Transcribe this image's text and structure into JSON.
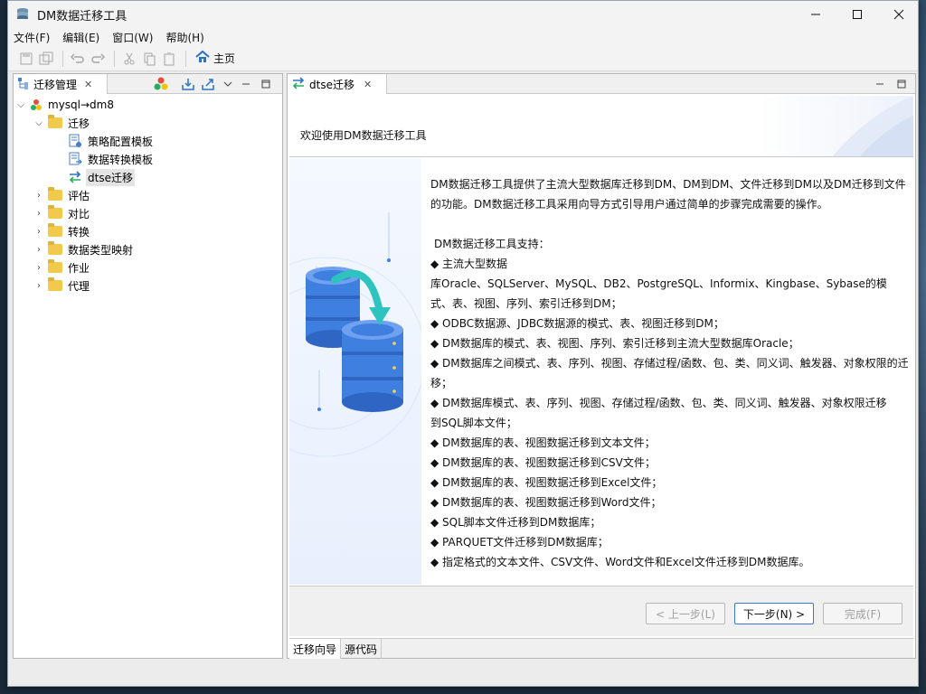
{
  "window": {
    "title": "DM数据迁移工具"
  },
  "menu": [
    {
      "label": "文件(F)"
    },
    {
      "label": "编辑(E)"
    },
    {
      "label": "窗口(W)"
    },
    {
      "label": "帮助(H)"
    }
  ],
  "toolbar": {
    "home_label": "主页"
  },
  "left_panel": {
    "tab_label": "迁移管理"
  },
  "tree": {
    "root": "mysql→dm8",
    "migration_folder": "迁移",
    "children": [
      "策略配置模板",
      "数据转换模板",
      "dtse迁移"
    ],
    "folders": [
      "评估",
      "对比",
      "转换",
      "数据类型映射",
      "作业",
      "代理"
    ]
  },
  "right_panel": {
    "tab_label": "dtse迁移"
  },
  "wizard": {
    "welcome": "欢迎使用DM数据迁移工具",
    "intro": "DM数据迁移工具提供了主流大型数据库迁移到DM、DM到DM、文件迁移到DM以及DM迁移到文件的功能。DM数据迁移工具采用向导方式引导用户通过简单的步骤完成需要的操作。",
    "support_title": "DM数据迁移工具支持：",
    "features": [
      "◆ 主流大型数据",
      "库Oracle、SQLServer、MySQL、DB2、PostgreSQL、Informix、Kingbase、Sybase的模",
      "式、表、视图、序列、索引迁移到DM；",
      "◆ ODBC数据源、JDBC数据源的模式、表、视图迁移到DM；",
      "◆ DM数据库的模式、表、视图、序列、索引迁移到主流大型数据库Oracle；",
      "◆ DM数据库之间模式、表、序列、视图、存储过程/函数、包、类、同义词、触发器、对象权限的迁",
      "移；",
      "◆ DM数据库模式、表、序列、视图、存储过程/函数、包、类、同义词、触发器、对象权限迁移",
      "到SQL脚本文件；",
      "◆ DM数据库的表、视图数据迁移到文本文件；",
      "◆ DM数据库的表、视图数据迁移到CSV文件；",
      "◆ DM数据库的表、视图数据迁移到Excel文件；",
      "◆ DM数据库的表、视图数据迁移到Word文件；",
      "◆ SQL脚本文件迁移到DM数据库；",
      "◆ PARQUET文件迁移到DM数据库；",
      "◆ 指定格式的文本文件、CSV文件、Word文件和Excel文件迁移到DM数据库。"
    ],
    "buttons": {
      "prev": "< 上一步(L)",
      "next": "下一步(N) >",
      "finish": "完成(F)"
    }
  },
  "bottom_tabs": [
    "迁移向导",
    "源代码"
  ],
  "colors": {
    "accent": "#3a78d0",
    "folder": "#f2c94c",
    "db_blue": "#3f7fe0",
    "arrow_teal": "#2fc3c0"
  },
  "icons": {
    "app": "database-stack-icon",
    "home": "home-icon",
    "tree_root": "connection-icon",
    "arrow": "migrate-arrows-icon"
  }
}
